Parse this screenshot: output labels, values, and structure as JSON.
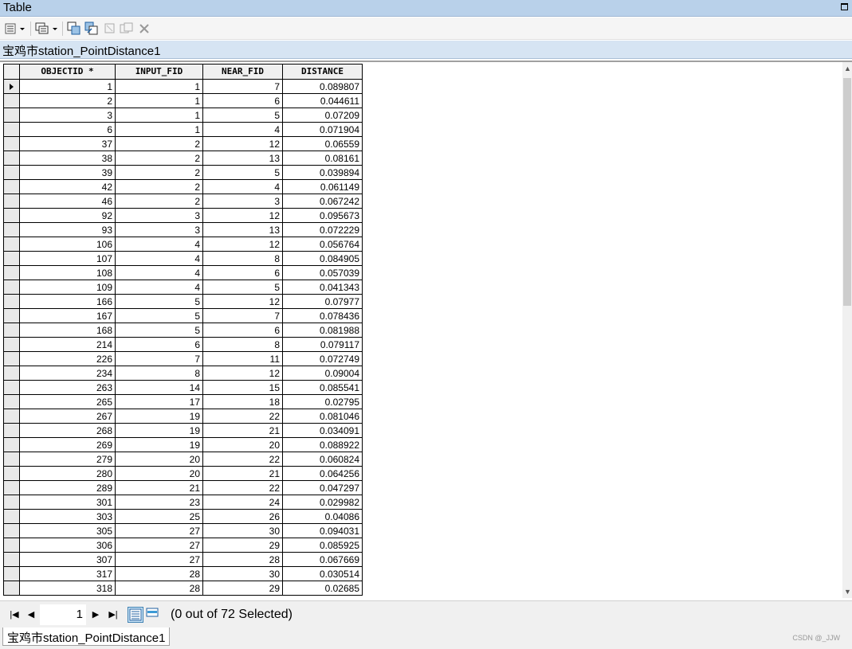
{
  "window": {
    "title": "Table"
  },
  "toolbar": {
    "icons": [
      "table-options-icon",
      "related-tables-icon",
      "select-by-attributes-icon",
      "switch-selection-icon",
      "clear-selection-icon",
      "zoom-to-selected-icon",
      "delete-selected-icon"
    ]
  },
  "table_title": "宝鸡市station_PointDistance1",
  "columns": [
    "OBJECTID *",
    "INPUT_FID",
    "NEAR_FID",
    "DISTANCE"
  ],
  "rows": [
    [
      "1",
      "1",
      "7",
      "0.089807"
    ],
    [
      "2",
      "1",
      "6",
      "0.044611"
    ],
    [
      "3",
      "1",
      "5",
      "0.07209"
    ],
    [
      "6",
      "1",
      "4",
      "0.071904"
    ],
    [
      "37",
      "2",
      "12",
      "0.06559"
    ],
    [
      "38",
      "2",
      "13",
      "0.08161"
    ],
    [
      "39",
      "2",
      "5",
      "0.039894"
    ],
    [
      "42",
      "2",
      "4",
      "0.061149"
    ],
    [
      "46",
      "2",
      "3",
      "0.067242"
    ],
    [
      "92",
      "3",
      "12",
      "0.095673"
    ],
    [
      "93",
      "3",
      "13",
      "0.072229"
    ],
    [
      "106",
      "4",
      "12",
      "0.056764"
    ],
    [
      "107",
      "4",
      "8",
      "0.084905"
    ],
    [
      "108",
      "4",
      "6",
      "0.057039"
    ],
    [
      "109",
      "4",
      "5",
      "0.041343"
    ],
    [
      "166",
      "5",
      "12",
      "0.07977"
    ],
    [
      "167",
      "5",
      "7",
      "0.078436"
    ],
    [
      "168",
      "5",
      "6",
      "0.081988"
    ],
    [
      "214",
      "6",
      "8",
      "0.079117"
    ],
    [
      "226",
      "7",
      "11",
      "0.072749"
    ],
    [
      "234",
      "8",
      "12",
      "0.09004"
    ],
    [
      "263",
      "14",
      "15",
      "0.085541"
    ],
    [
      "265",
      "17",
      "18",
      "0.02795"
    ],
    [
      "267",
      "19",
      "22",
      "0.081046"
    ],
    [
      "268",
      "19",
      "21",
      "0.034091"
    ],
    [
      "269",
      "19",
      "20",
      "0.088922"
    ],
    [
      "279",
      "20",
      "22",
      "0.060824"
    ],
    [
      "280",
      "20",
      "21",
      "0.064256"
    ],
    [
      "289",
      "21",
      "22",
      "0.047297"
    ],
    [
      "301",
      "23",
      "24",
      "0.029982"
    ],
    [
      "303",
      "25",
      "26",
      "0.04086"
    ],
    [
      "305",
      "27",
      "30",
      "0.094031"
    ],
    [
      "306",
      "27",
      "29",
      "0.085925"
    ],
    [
      "307",
      "27",
      "28",
      "0.067669"
    ],
    [
      "317",
      "28",
      "30",
      "0.030514"
    ],
    [
      "318",
      "28",
      "29",
      "0.02685"
    ]
  ],
  "nav": {
    "current_record": "1",
    "selection_status": "(0 out of 72 Selected)"
  },
  "bottom_tab": "宝鸡市station_PointDistance1",
  "watermark": "CSDN @_JJW"
}
